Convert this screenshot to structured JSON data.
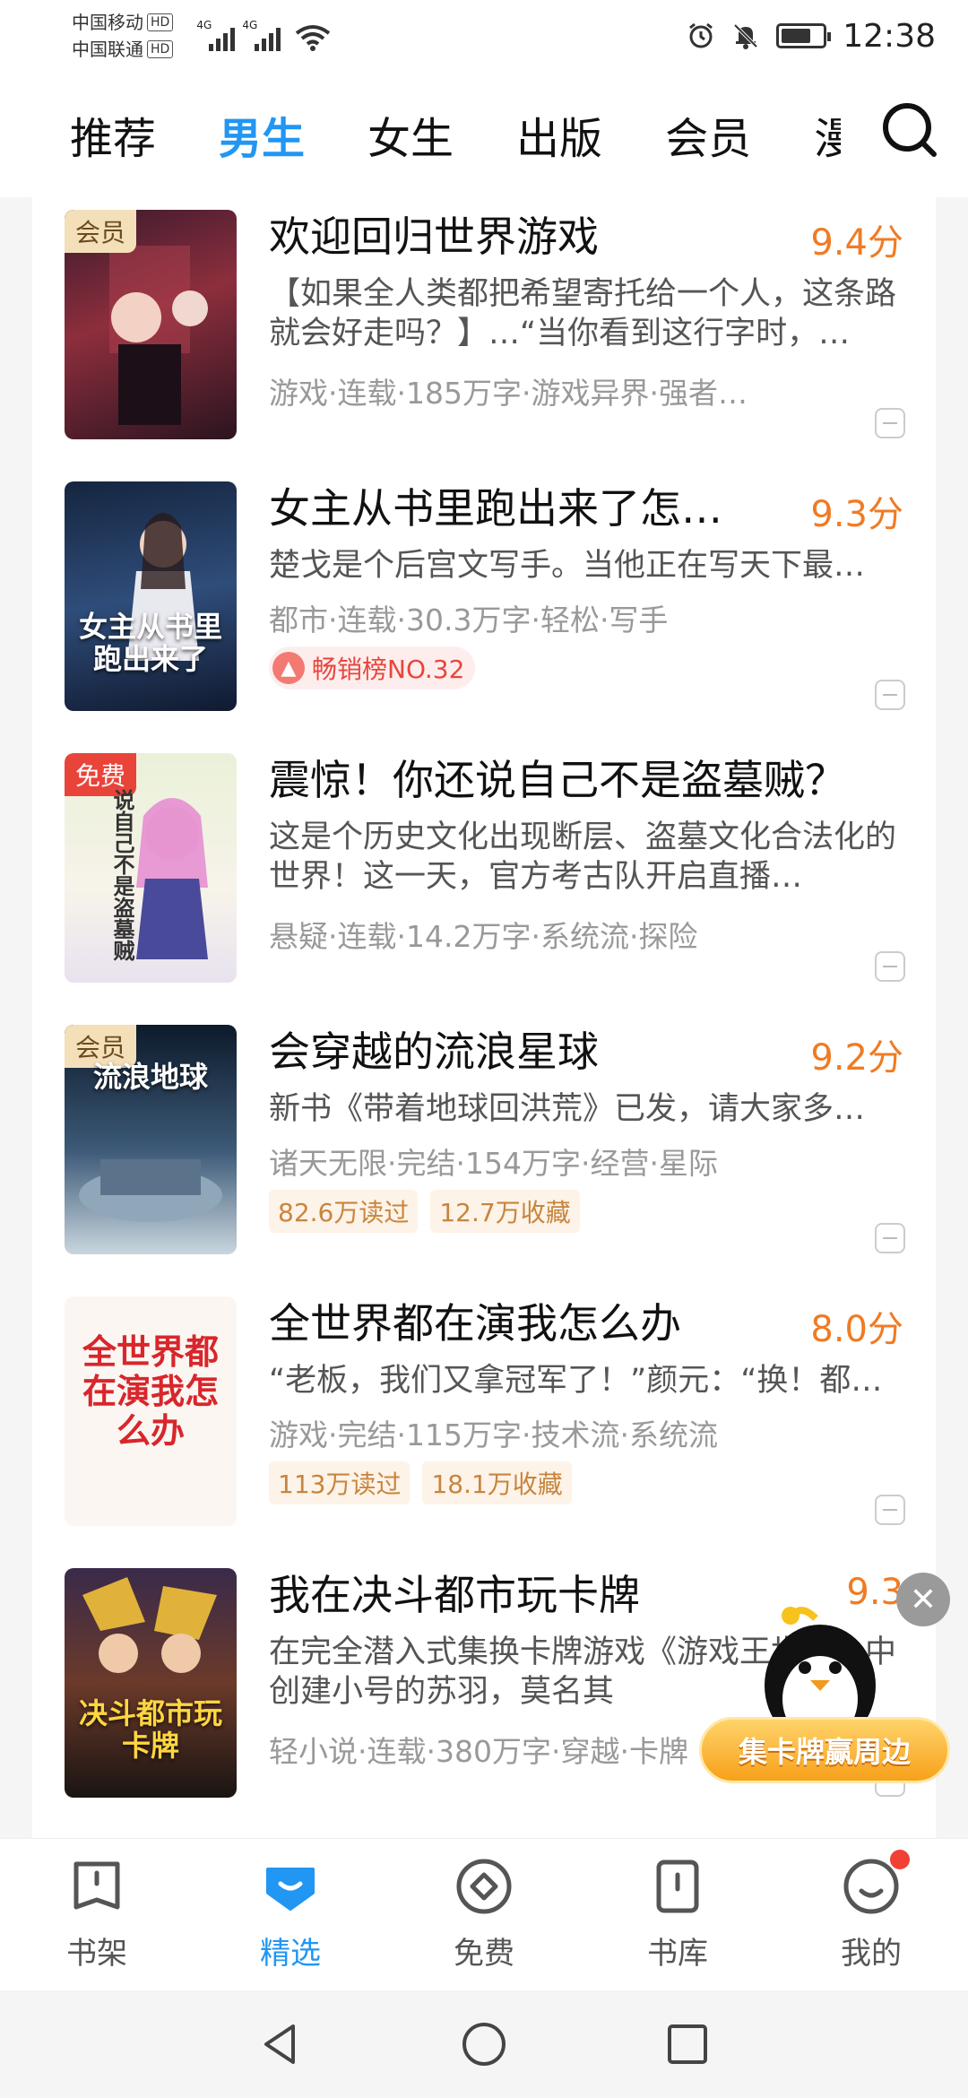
{
  "status_bar": {
    "carrier1": "中国移动",
    "carrier2": "中国联通",
    "hd": "HD",
    "network1": "4G",
    "network2": "4G",
    "time": "12:38"
  },
  "top_nav": {
    "tabs": [
      "推荐",
      "男生",
      "女生",
      "出版",
      "会员",
      "漫画"
    ],
    "active_tab": "男生"
  },
  "books": [
    {
      "title": "欢迎回归世界游戏",
      "score": "9.4分",
      "badge": "会员",
      "cover_text": "",
      "desc": "【如果全人类都把希望寄托给一个人，这条路就会好走吗？】…“当你看到这行字时，…",
      "meta": "游戏·连载·185万字·游戏异界·强者…"
    },
    {
      "title": "女主从书里跑出来了怎…",
      "score": "9.3分",
      "badge": "",
      "cover_text": "女主从书里跑出来了",
      "desc": "楚戈是个后宫文写手。当他正在写天下最…",
      "meta": "都市·连载·30.3万字·轻松·写手",
      "rank": "畅销榜NO.32"
    },
    {
      "title": "震惊！你还说自己不是盗墓贼？",
      "score": "",
      "badge": "免费",
      "cover_text": "说自己不是盗墓贼",
      "desc": "这是个历史文化出现断层、盗墓文化合法化的世界！这一天，官方考古队开启直播…",
      "meta": "悬疑·连载·14.2万字·系统流·探险"
    },
    {
      "title": "会穿越的流浪星球",
      "score": "9.2分",
      "badge": "会员",
      "cover_text": "流浪地球",
      "desc": "新书《带着地球回洪荒》已发，请大家多…",
      "meta": "诸天无限·完结·154万字·经营·星际",
      "chips": [
        "82.6万读过",
        "12.7万收藏"
      ]
    },
    {
      "title": "全世界都在演我怎么办",
      "score": "8.0分",
      "badge": "",
      "cover_text": "全世界都在演我怎么办",
      "desc": "“老板，我们又拿冠军了！”颜元：“换！都…",
      "meta": "游戏·完结·115万字·技术流·系统流",
      "chips": [
        "113万读过",
        "18.1万收藏"
      ]
    },
    {
      "title": "我在决斗都市玩卡牌",
      "score": "9.3",
      "badge": "",
      "cover_text": "决斗都市玩卡牌",
      "desc": "在完全潜入式集换卡牌游戏《游戏王世界》中创建小号的苏羽，莫名其",
      "meta": "轻小说·连载·380万字·穿越·卡牌"
    }
  ],
  "promo": {
    "label": "集卡牌赢周边",
    "close": "✕"
  },
  "bottom_nav": [
    {
      "label": "书架",
      "icon": "bookshelf-icon"
    },
    {
      "label": "精选",
      "icon": "featured-icon"
    },
    {
      "label": "免费",
      "icon": "free-icon"
    },
    {
      "label": "书库",
      "icon": "library-icon"
    },
    {
      "label": "我的",
      "icon": "profile-icon"
    }
  ],
  "colors": {
    "accent": "#2196f3",
    "score": "#f07b24",
    "badge_free": "#e9443a",
    "notification_dot": "#f04134"
  }
}
